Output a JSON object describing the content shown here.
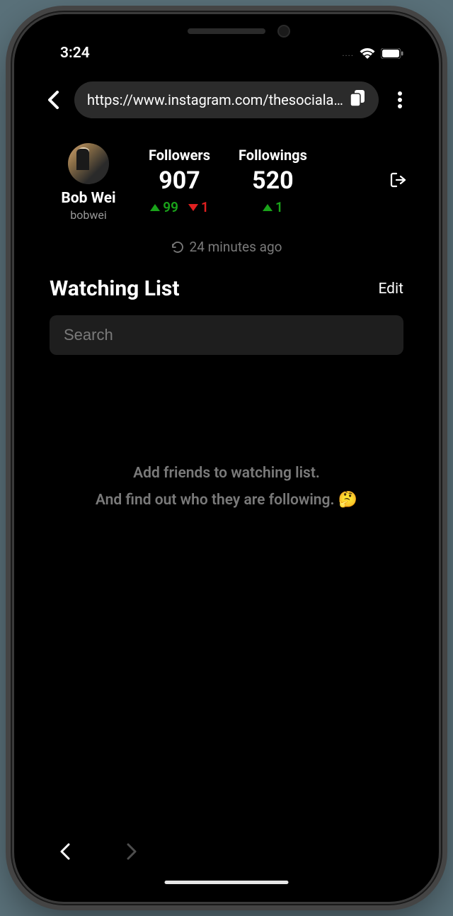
{
  "status": {
    "time": "3:24",
    "dots": "...."
  },
  "urlbar": {
    "url": "https://www.instagram.com/thesociala..."
  },
  "profile": {
    "display_name": "Bob Wei",
    "username": "bobwei"
  },
  "stats": {
    "followers": {
      "label": "Followers",
      "value": "907",
      "up": "99",
      "down": "1"
    },
    "followings": {
      "label": "Followings",
      "value": "520",
      "up": "1"
    }
  },
  "updated": {
    "text": "24 minutes ago"
  },
  "watching": {
    "title": "Watching List",
    "edit": "Edit",
    "search_placeholder": "Search"
  },
  "empty": {
    "line1": "Add friends to watching list.",
    "line2": "And find out who they are following.",
    "emoji": "🤔"
  }
}
